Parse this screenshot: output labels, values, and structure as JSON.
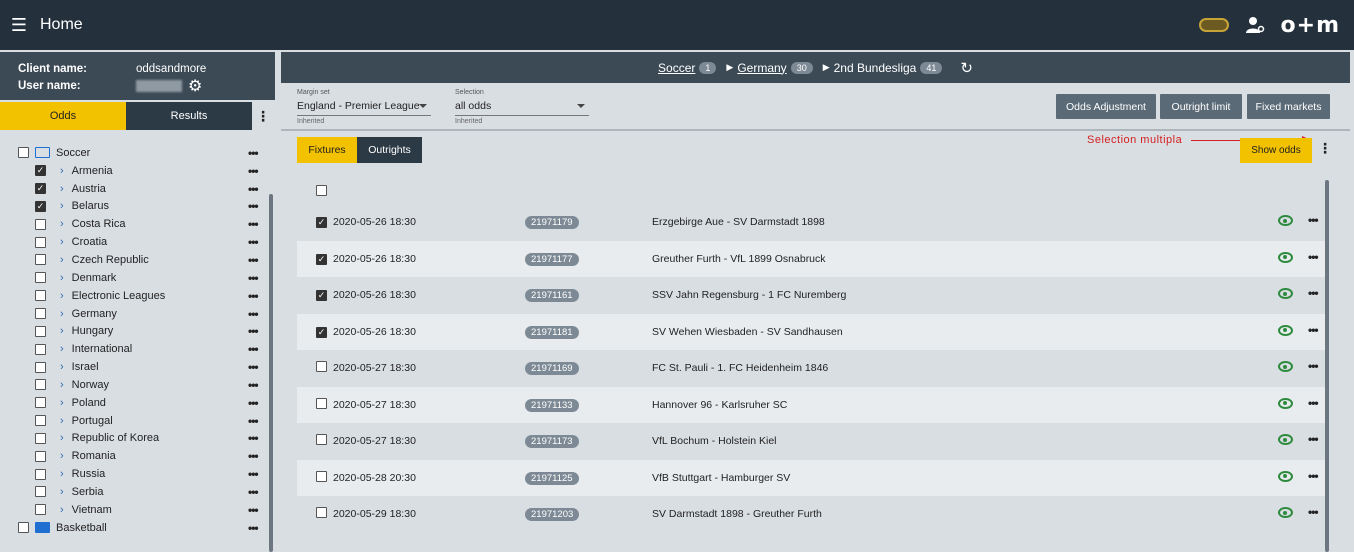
{
  "topbar": {
    "title": "Home",
    "logo": "o+m",
    "menu_icon": "hamburger-icon",
    "user_icon": "user-settings-icon"
  },
  "client": {
    "client_label": "Client name:",
    "client_value": "oddsandmore",
    "user_label": "User name:"
  },
  "left_tabs": {
    "odds": "Odds",
    "results": "Results"
  },
  "tree": {
    "root": "Soccer",
    "items": [
      {
        "label": "Armenia",
        "checked": true
      },
      {
        "label": "Austria",
        "checked": true
      },
      {
        "label": "Belarus",
        "checked": true
      },
      {
        "label": "Costa Rica",
        "checked": false
      },
      {
        "label": "Croatia",
        "checked": false
      },
      {
        "label": "Czech Republic",
        "checked": false
      },
      {
        "label": "Denmark",
        "checked": false
      },
      {
        "label": "Electronic Leagues",
        "checked": false
      },
      {
        "label": "Germany",
        "checked": false
      },
      {
        "label": "Hungary",
        "checked": false
      },
      {
        "label": "International",
        "checked": false
      },
      {
        "label": "Israel",
        "checked": false
      },
      {
        "label": "Norway",
        "checked": false
      },
      {
        "label": "Poland",
        "checked": false
      },
      {
        "label": "Portugal",
        "checked": false
      },
      {
        "label": "Republic of Korea",
        "checked": false
      },
      {
        "label": "Romania",
        "checked": false
      },
      {
        "label": "Russia",
        "checked": false
      },
      {
        "label": "Serbia",
        "checked": false
      },
      {
        "label": "Vietnam",
        "checked": false
      }
    ],
    "next_root": "Basketball"
  },
  "breadcrumb": {
    "sport": "Soccer",
    "sport_count": "1",
    "country": "Germany",
    "country_count": "30",
    "league": "2nd Bundesliga",
    "league_count": "41"
  },
  "filters": {
    "margin": {
      "label": "Margin set",
      "value": "England - Premier League",
      "sub": "Inherited"
    },
    "selection": {
      "label": "Selection",
      "value": "all odds",
      "sub": "Inherited"
    }
  },
  "buttons": {
    "odds_adjustment": "Odds Adjustment",
    "outright_limit": "Outright limit",
    "fixed_markets": "Fixed markets",
    "show_odds": "Show odds"
  },
  "subtabs": {
    "fixtures": "Fixtures",
    "outrights": "Outrights"
  },
  "annotation": "Selection multipla",
  "fixtures": [
    {
      "date": "2020-05-26 18:30",
      "id": "21971179",
      "name": "Erzgebirge Aue - SV Darmstadt 1898",
      "checked": true
    },
    {
      "date": "2020-05-26 18:30",
      "id": "21971177",
      "name": "Greuther Furth - VfL 1899 Osnabruck",
      "checked": true
    },
    {
      "date": "2020-05-26 18:30",
      "id": "21971161",
      "name": "SSV Jahn Regensburg - 1 FC Nuremberg",
      "checked": true
    },
    {
      "date": "2020-05-26 18:30",
      "id": "21971181",
      "name": "SV Wehen Wiesbaden - SV Sandhausen",
      "checked": true
    },
    {
      "date": "2020-05-27 18:30",
      "id": "21971169",
      "name": "FC St. Pauli - 1. FC Heidenheim 1846",
      "checked": false
    },
    {
      "date": "2020-05-27 18:30",
      "id": "21971133",
      "name": "Hannover 96 - Karlsruher SC",
      "checked": false
    },
    {
      "date": "2020-05-27 18:30",
      "id": "21971173",
      "name": "VfL Bochum - Holstein Kiel",
      "checked": false
    },
    {
      "date": "2020-05-28 20:30",
      "id": "21971125",
      "name": "VfB Stuttgart - Hamburger SV",
      "checked": false
    },
    {
      "date": "2020-05-29 18:30",
      "id": "21971203",
      "name": "SV Darmstadt 1898 - Greuther Furth",
      "checked": false
    }
  ]
}
